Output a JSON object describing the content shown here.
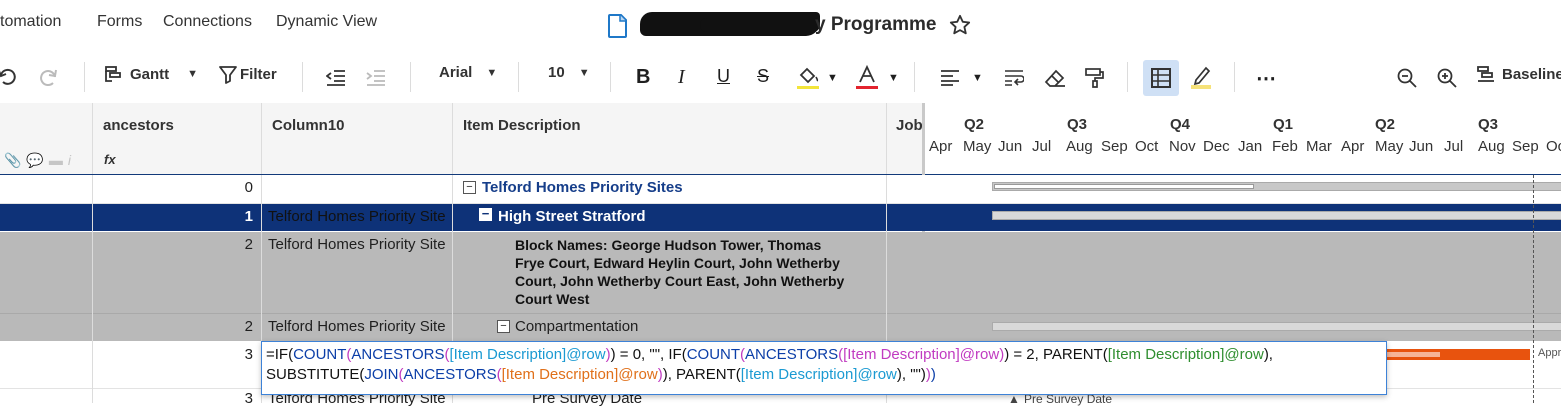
{
  "nav": {
    "items": [
      "tomation",
      "Forms",
      "Connections",
      "Dynamic View"
    ],
    "title_suffix": "y Programme"
  },
  "toolbar": {
    "view": "Gantt",
    "filter": "Filter",
    "font": "Arial",
    "size": "10",
    "baseline": "Baseline"
  },
  "grid": {
    "headers": {
      "ancestors": "ancestors",
      "column10": "Column10",
      "item_description": "Item Description",
      "job": "Job"
    },
    "formula_indicator": "fx",
    "rows": [
      {
        "ancestors": "0",
        "column10": "",
        "item": "Telford Homes Priority Sites"
      },
      {
        "ancestors": "1",
        "column10": "Telford Homes Priority Site",
        "item": "High Street Stratford"
      },
      {
        "ancestors": "2",
        "column10": "Telford Homes Priority Site",
        "item_lines": [
          "Block Names: George Hudson Tower, Thomas",
          "Frye Court, Edward Heylin Court, John Wetherby",
          "Court, John Wetherby Court East, John Wetherby",
          "Court West"
        ]
      },
      {
        "ancestors": "2",
        "column10": "Telford Homes Priority Site",
        "item": "Compartmentation"
      },
      {
        "ancestors": "3",
        "column10": "",
        "item": ""
      },
      {
        "ancestors": "3",
        "column10": "Telford Homes Priority Site",
        "item": "Pre Survey Date"
      }
    ]
  },
  "gantt": {
    "quarters": [
      "Q2",
      "Q3",
      "Q4",
      "Q1",
      "Q2",
      "Q3"
    ],
    "months": [
      "Apr",
      "May",
      "Jun",
      "Jul",
      "Aug",
      "Sep",
      "Oct",
      "Nov",
      "Dec",
      "Jan",
      "Feb",
      "Mar",
      "Apr",
      "May",
      "Jun",
      "Jul",
      "Aug",
      "Sep",
      "Oc"
    ],
    "labels": {
      "approved": "Appr",
      "pre_survey": "Pre Survey Date"
    }
  },
  "formula": {
    "line1": [
      [
        "t",
        "=IF("
      ],
      [
        "fn",
        "COUNT"
      ],
      [
        "p",
        "("
      ],
      [
        "fn",
        "ANCESTORS"
      ],
      [
        "p",
        "("
      ],
      [
        "c1",
        "[Item Description]@row"
      ],
      [
        "p",
        ")"
      ],
      [
        "t",
        ") = 0, \"\", IF("
      ],
      [
        "fn",
        "COUNT"
      ],
      [
        "p",
        "("
      ],
      [
        "fn",
        "ANCESTORS"
      ],
      [
        "p",
        "("
      ],
      [
        "c2",
        "[Item Description]@row"
      ],
      [
        "p",
        ")"
      ],
      [
        "t",
        ") = 2, PARENT("
      ],
      [
        "c3",
        "[Item Description]@row"
      ],
      [
        "t",
        "),"
      ]
    ],
    "line2": [
      [
        "t",
        "SUBSTITUTE("
      ],
      [
        "fn",
        "JOIN"
      ],
      [
        "p",
        "("
      ],
      [
        "fn",
        "ANCESTORS"
      ],
      [
        "p",
        "("
      ],
      [
        "c4",
        "[Item Description]@row"
      ],
      [
        "p",
        ")"
      ],
      [
        "t",
        "), PARENT("
      ],
      [
        "c1",
        "[Item Description]@row"
      ],
      [
        "t",
        "), \"\")"
      ],
      [
        "p",
        ")"
      ],
      [
        "fn",
        ")"
      ]
    ]
  },
  "colors": {
    "selected_row": "#0e3278",
    "gray_row": "#b9b9b9",
    "accent": "#3d82d7",
    "bar_orange": "#e8530e"
  }
}
